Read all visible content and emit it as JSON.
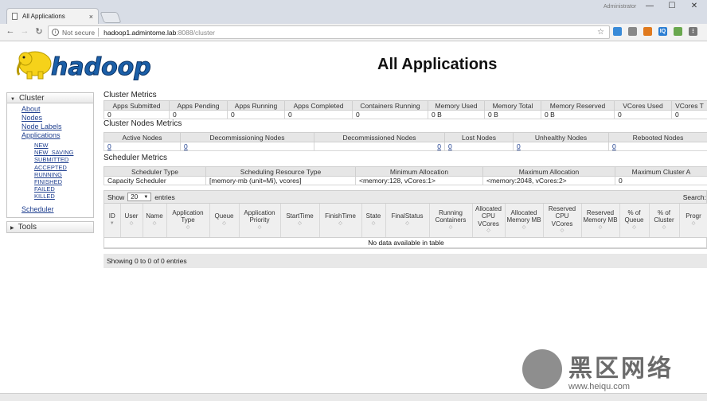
{
  "browser": {
    "tab_title": "All Applications",
    "tab_close": "×",
    "user": "Administrator",
    "window_controls": [
      "—",
      "☐",
      "✕"
    ],
    "nav": {
      "back": "←",
      "forward": "→",
      "reload": "↻"
    },
    "not_secure": "Not secure",
    "url_host": "hadoop1.admintome.lab",
    "url_path": ":8088/cluster",
    "extensions": [
      "extension-icon",
      "puzzle-icon",
      "iq-icon",
      "shield-icon",
      "menu-icon"
    ]
  },
  "page": {
    "logo_text": "hadoop",
    "title": "All Applications"
  },
  "sidebar": {
    "cluster_label": "Cluster",
    "cluster_links": [
      "About",
      "Nodes",
      "Node Labels",
      "Applications"
    ],
    "app_states": [
      "NEW",
      "NEW_SAVING",
      "SUBMITTED",
      "ACCEPTED",
      "RUNNING",
      "FINISHED",
      "FAILED",
      "KILLED"
    ],
    "scheduler_label": "Scheduler",
    "tools_label": "Tools"
  },
  "cluster_metrics": {
    "title": "Cluster Metrics",
    "headers": [
      "Apps Submitted",
      "Apps Pending",
      "Apps Running",
      "Apps Completed",
      "Containers Running",
      "Memory Used",
      "Memory Total",
      "Memory Reserved",
      "VCores Used",
      "VCores T"
    ],
    "values": [
      "0",
      "0",
      "0",
      "0",
      "0",
      "0 B",
      "0 B",
      "0 B",
      "0",
      "0"
    ]
  },
  "node_metrics": {
    "title": "Cluster Nodes Metrics",
    "headers": [
      "Active Nodes",
      "Decommissioning Nodes",
      "Decommissioned Nodes",
      "Lost Nodes",
      "Unhealthy Nodes",
      "Rebooted Nodes"
    ],
    "values": [
      "0",
      "0",
      "0",
      "0",
      "0",
      "0"
    ]
  },
  "scheduler_metrics": {
    "title": "Scheduler Metrics",
    "headers": [
      "Scheduler Type",
      "Scheduling Resource Type",
      "Minimum Allocation",
      "Maximum Allocation",
      "Maximum Cluster A"
    ],
    "values": [
      "Capacity Scheduler",
      "[memory-mb (unit=Mi), vcores]",
      "<memory:128, vCores:1>",
      "<memory:2048, vCores:2>",
      "0"
    ]
  },
  "apps_table": {
    "show_label": "Show",
    "page_size": "20",
    "entries_label": "entries",
    "search_label": "Search:",
    "columns": [
      "ID",
      "User",
      "Name",
      "Application Type",
      "Queue",
      "Application Priority",
      "StartTime",
      "FinishTime",
      "State",
      "FinalStatus",
      "Running Containers",
      "Allocated CPU VCores",
      "Allocated Memory MB",
      "Reserved CPU VCores",
      "Reserved Memory MB",
      "% of Queue",
      "% of Cluster",
      "Progr"
    ],
    "empty_message": "No data available in table",
    "footer": "Showing 0 to 0 of 0 entries"
  },
  "watermark": {
    "text": "黑区网络",
    "url": "www.heiqu.com"
  },
  "colors": {
    "link": "#1f3f8f",
    "logo_yellow": "#f6d21a",
    "logo_blue": "#1b5fa8"
  }
}
